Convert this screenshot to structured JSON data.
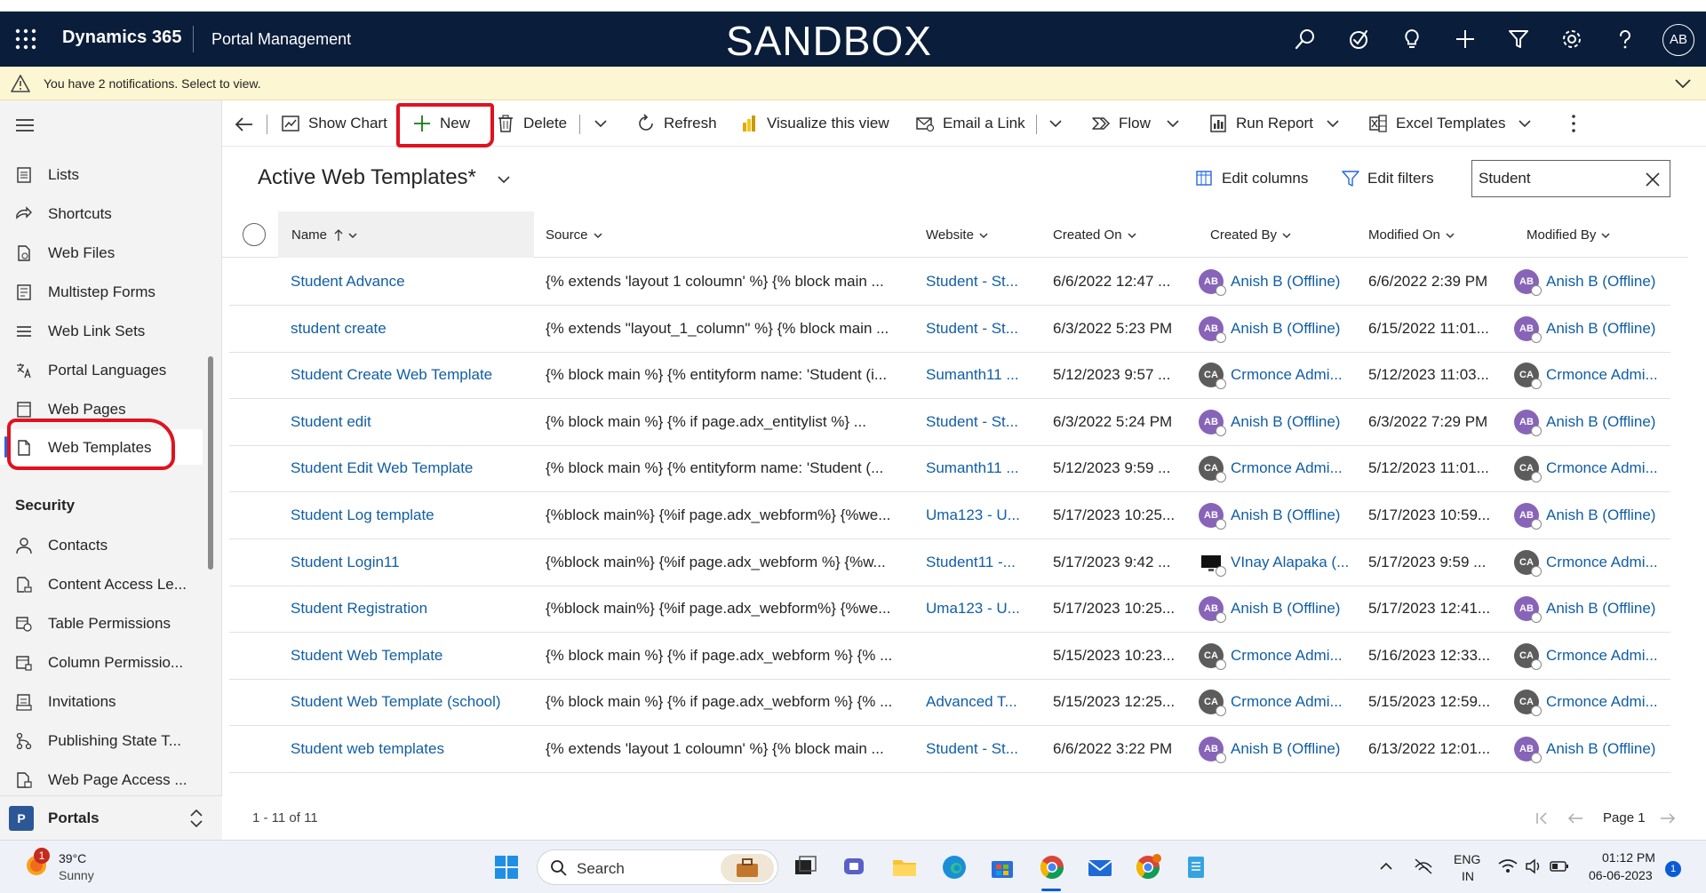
{
  "header": {
    "brand": "Dynamics 365",
    "app_name": "Portal Management",
    "environment": "SANDBOX",
    "avatar_initials": "AB",
    "icons": [
      "search-icon",
      "task-icon",
      "lightbulb-icon",
      "plus-icon",
      "filter-icon",
      "gear-icon",
      "help-icon"
    ]
  },
  "notification": {
    "message": "You have 2 notifications. Select to view."
  },
  "sidebar": {
    "items": [
      {
        "label": "Lists",
        "icon": "list-icon"
      },
      {
        "label": "Shortcuts",
        "icon": "shortcut-icon"
      },
      {
        "label": "Web Files",
        "icon": "file-icon"
      },
      {
        "label": "Multistep Forms",
        "icon": "form-icon"
      },
      {
        "label": "Web Link Sets",
        "icon": "lines-icon"
      },
      {
        "label": "Portal Languages",
        "icon": "language-icon"
      },
      {
        "label": "Web Pages",
        "icon": "web-pages-icon"
      },
      {
        "label": "Web Templates",
        "icon": "page-icon"
      }
    ],
    "security_heading": "Security",
    "security_items": [
      {
        "label": "Contacts",
        "icon": "person-icon"
      },
      {
        "label": "Content Access Le...",
        "icon": "document-lock-icon"
      },
      {
        "label": "Table Permissions",
        "icon": "table-permissions-icon"
      },
      {
        "label": "Column Permissio...",
        "icon": "column-permissions-icon"
      },
      {
        "label": "Invitations",
        "icon": "invitation-icon"
      },
      {
        "label": "Publishing State T...",
        "icon": "flow-icon"
      },
      {
        "label": "Web Page Access ...",
        "icon": "page-access-icon"
      }
    ],
    "area": {
      "badge": "P",
      "label": "Portals"
    }
  },
  "commandbar": {
    "show_chart": "Show Chart",
    "new": "New",
    "delete": "Delete",
    "refresh": "Refresh",
    "visualize": "Visualize this view",
    "email_link": "Email a Link",
    "flow": "Flow",
    "run_report": "Run Report",
    "excel_templates": "Excel Templates"
  },
  "view": {
    "title": "Active Web Templates*",
    "edit_columns": "Edit columns",
    "edit_filters": "Edit filters",
    "search_value": "Student"
  },
  "grid": {
    "columns": [
      "Name",
      "Source",
      "Website",
      "Created On",
      "Created By",
      "Modified On",
      "Modified By"
    ],
    "rows": [
      {
        "name": "Student Advance",
        "source": "{% extends 'layout 1 coloumn' %} {% block main ...",
        "website": "Student - St...",
        "created_on": "6/6/2022 12:47 ...",
        "created_by": "Anish B (Offline)",
        "cb_type": "ab",
        "cb_init": "AB",
        "modified_on": "6/6/2022 2:39 PM",
        "modified_by": "Anish B (Offline)",
        "mb_type": "ab",
        "mb_init": "AB"
      },
      {
        "name": "student create",
        "source": "{% extends \"layout_1_column\" %} {% block main ...",
        "website": "Student - St...",
        "created_on": "6/3/2022 5:23 PM",
        "created_by": "Anish B (Offline)",
        "cb_type": "ab",
        "cb_init": "AB",
        "modified_on": "6/15/2022 11:01...",
        "modified_by": "Anish B (Offline)",
        "mb_type": "ab",
        "mb_init": "AB"
      },
      {
        "name": "Student Create Web Template",
        "source": "{% block main %} {% entityform name: 'Student (i...",
        "website": "Sumanth11 ...",
        "created_on": "5/12/2023 9:57 ...",
        "created_by": "Crmonce Admi...",
        "cb_type": "ca",
        "cb_init": "CA",
        "modified_on": "5/12/2023 11:03...",
        "modified_by": "Crmonce Admi...",
        "mb_type": "ca",
        "mb_init": "CA"
      },
      {
        "name": "Student edit",
        "source": "{% block main %}     {% if page.adx_entitylist %}   ...",
        "website": "Student - St...",
        "created_on": "6/3/2022 5:24 PM",
        "created_by": "Anish B (Offline)",
        "cb_type": "ab",
        "cb_init": "AB",
        "modified_on": "6/3/2022 7:29 PM",
        "modified_by": "Anish B (Offline)",
        "mb_type": "ab",
        "mb_init": "AB"
      },
      {
        "name": "Student Edit Web Template",
        "source": "{% block main %} {% entityform name: 'Student (...",
        "website": "Sumanth11 ...",
        "created_on": "5/12/2023 9:59 ...",
        "created_by": "Crmonce Admi...",
        "cb_type": "ca",
        "cb_init": "CA",
        "modified_on": "5/12/2023 11:01...",
        "modified_by": "Crmonce Admi...",
        "mb_type": "ca",
        "mb_init": "CA"
      },
      {
        "name": "Student Log template",
        "source": "{%block main%} {%if page.adx_webform%} {%we...",
        "website": "Uma123 - U...",
        "created_on": "5/17/2023 10:25...",
        "created_by": "Anish B (Offline)",
        "cb_type": "ab",
        "cb_init": "AB",
        "modified_on": "5/17/2023 10:59...",
        "modified_by": "Anish B (Offline)",
        "mb_type": "ab",
        "mb_init": "AB"
      },
      {
        "name": "Student Login11",
        "source": "{%block main%} {%if page.adx_webform %} {%w...",
        "website": "Student11 -...",
        "created_on": "5/17/2023 9:42 ...",
        "created_by": "VInay Alapaka (...",
        "cb_type": "pc",
        "cb_init": "",
        "modified_on": "5/17/2023 9:59 ...",
        "modified_by": "Crmonce Admi...",
        "mb_type": "ca",
        "mb_init": "CA"
      },
      {
        "name": "Student Registration",
        "source": "{%block main%} {%if page.adx_webform%} {%we...",
        "website": "Uma123 - U...",
        "created_on": "5/17/2023 10:25...",
        "created_by": "Anish B (Offline)",
        "cb_type": "ab",
        "cb_init": "AB",
        "modified_on": "5/17/2023 12:41...",
        "modified_by": "Anish B (Offline)",
        "mb_type": "ab",
        "mb_init": "AB"
      },
      {
        "name": "Student Web Template",
        "source": "{% block main %} {% if page.adx_webform %} {% ...",
        "website": "",
        "created_on": "5/15/2023 10:23...",
        "created_by": "Crmonce Admi...",
        "cb_type": "ca",
        "cb_init": "CA",
        "modified_on": "5/16/2023 12:33...",
        "modified_by": "Crmonce Admi...",
        "mb_type": "ca",
        "mb_init": "CA"
      },
      {
        "name": "Student Web Template (school)",
        "source": "{% block main %} {% if page.adx_webform %} {% ...",
        "website": "Advanced T...",
        "created_on": "5/15/2023 12:25...",
        "created_by": "Crmonce Admi...",
        "cb_type": "ca",
        "cb_init": "CA",
        "modified_on": "5/15/2023 12:59...",
        "modified_by": "Crmonce Admi...",
        "mb_type": "ca",
        "mb_init": "CA"
      },
      {
        "name": "Student web templates",
        "source": "{% extends 'layout 1 coloumn' %} {% block main ...",
        "website": "Student - St...",
        "created_on": "6/6/2022 3:22 PM",
        "created_by": "Anish B (Offline)",
        "cb_type": "ab",
        "cb_init": "AB",
        "modified_on": "6/13/2022 12:01...",
        "modified_by": "Anish B (Offline)",
        "mb_type": "ab",
        "mb_init": "AB"
      }
    ],
    "record_count": "1 - 11 of 11",
    "page_label": "Page 1"
  },
  "taskbar": {
    "weather_temp": "39°C",
    "weather_desc": "Sunny",
    "weather_badge": "1",
    "search_label": "Search",
    "lang_1": "ENG",
    "lang_2": "IN",
    "time": "01:12 PM",
    "date": "06-06-2023",
    "notif_badge": "1"
  },
  "colors": {
    "header_bg": "#0a1d3a",
    "notification_bg": "#fdf6d2",
    "link": "#115ea3",
    "accent": "#2266e3",
    "annotation_red": "#e0121f"
  }
}
